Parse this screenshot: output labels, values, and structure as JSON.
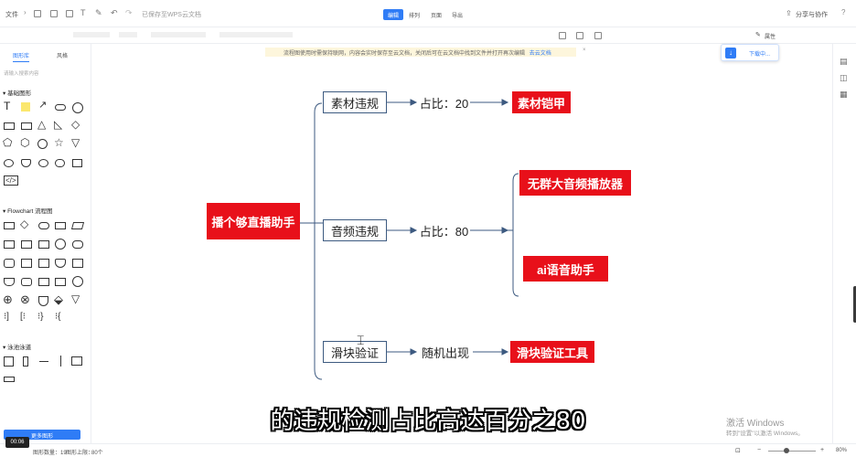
{
  "topbar": {
    "file_menu": "文件",
    "save_status": "已保存至WPS云文档",
    "tabs": [
      "编辑",
      "排列",
      "页面",
      "导出"
    ],
    "active_tab": "编辑",
    "share_label": "分享与协作"
  },
  "notice": {
    "text": "流程图使用时需保持联网，内容会实时保存至云文档，关闭后可在云文档中找到文件并打开再次编辑",
    "link": "去云文档"
  },
  "float_button": {
    "label": "下载中..."
  },
  "format_label": "属性",
  "left_panel": {
    "tabs": [
      "图形库",
      "风格"
    ],
    "search_placeholder": "请输入搜索内容",
    "sections": [
      "基础图形",
      "Flowchart 流程图",
      "泳池泳道"
    ],
    "more_button": "更多图形"
  },
  "mindmap": {
    "root": "播个够直播助手",
    "branches": [
      {
        "label": "素材违规",
        "mid": "占比：20",
        "leaves": [
          "素材铠甲"
        ]
      },
      {
        "label": "音频违规",
        "mid": "占比：80",
        "leaves": [
          "无群大音频播放器",
          "ai语音助手"
        ]
      },
      {
        "label": "滑块验证",
        "mid": "随机出现",
        "leaves": [
          "滑块验证工具"
        ]
      }
    ]
  },
  "subtitle": "的违规检测占比高达百分之80",
  "watermark": {
    "line1": "激活 Windows",
    "line2": "转到\"设置\"以激活 Windows。"
  },
  "statusbar": {
    "time": "00:06",
    "shape_count": "图形数量：19",
    "shape_limit": "图形上限：",
    "shape_limit_value": "80个",
    "zoom": "80%"
  },
  "colors": {
    "accent": "#2f7cf6",
    "node_red": "#e8101a",
    "node_border": "#3d5a80"
  }
}
